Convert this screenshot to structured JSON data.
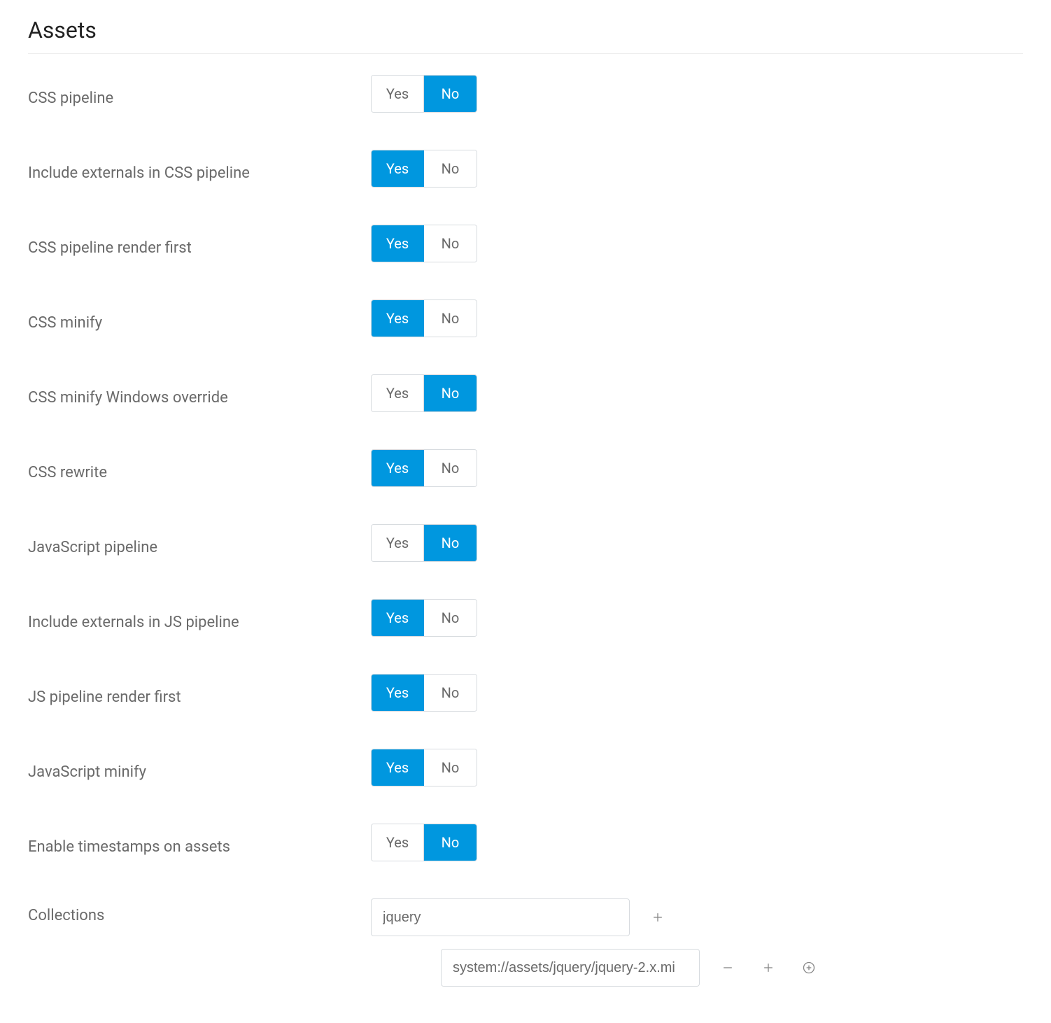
{
  "title": "Assets",
  "labels": {
    "yes": "Yes",
    "no": "No"
  },
  "settings": [
    {
      "key": "css-pipeline",
      "label": "CSS pipeline",
      "value": "no"
    },
    {
      "key": "include-externals-css",
      "label": "Include externals in CSS pipeline",
      "value": "yes"
    },
    {
      "key": "css-pipeline-render-first",
      "label": "CSS pipeline render first",
      "value": "yes"
    },
    {
      "key": "css-minify",
      "label": "CSS minify",
      "value": "yes"
    },
    {
      "key": "css-minify-windows",
      "label": "CSS minify Windows override",
      "value": "no"
    },
    {
      "key": "css-rewrite",
      "label": "CSS rewrite",
      "value": "yes"
    },
    {
      "key": "js-pipeline",
      "label": "JavaScript pipeline",
      "value": "no"
    },
    {
      "key": "include-externals-js",
      "label": "Include externals in JS pipeline",
      "value": "yes"
    },
    {
      "key": "js-pipeline-render-first",
      "label": "JS pipeline render first",
      "value": "yes"
    },
    {
      "key": "js-minify",
      "label": "JavaScript minify",
      "value": "yes"
    },
    {
      "key": "enable-timestamps",
      "label": "Enable timestamps on assets",
      "value": "no"
    }
  ],
  "collections": {
    "label": "Collections",
    "name": "jquery",
    "items": [
      "system://assets/jquery/jquery-2.x.mi"
    ]
  }
}
